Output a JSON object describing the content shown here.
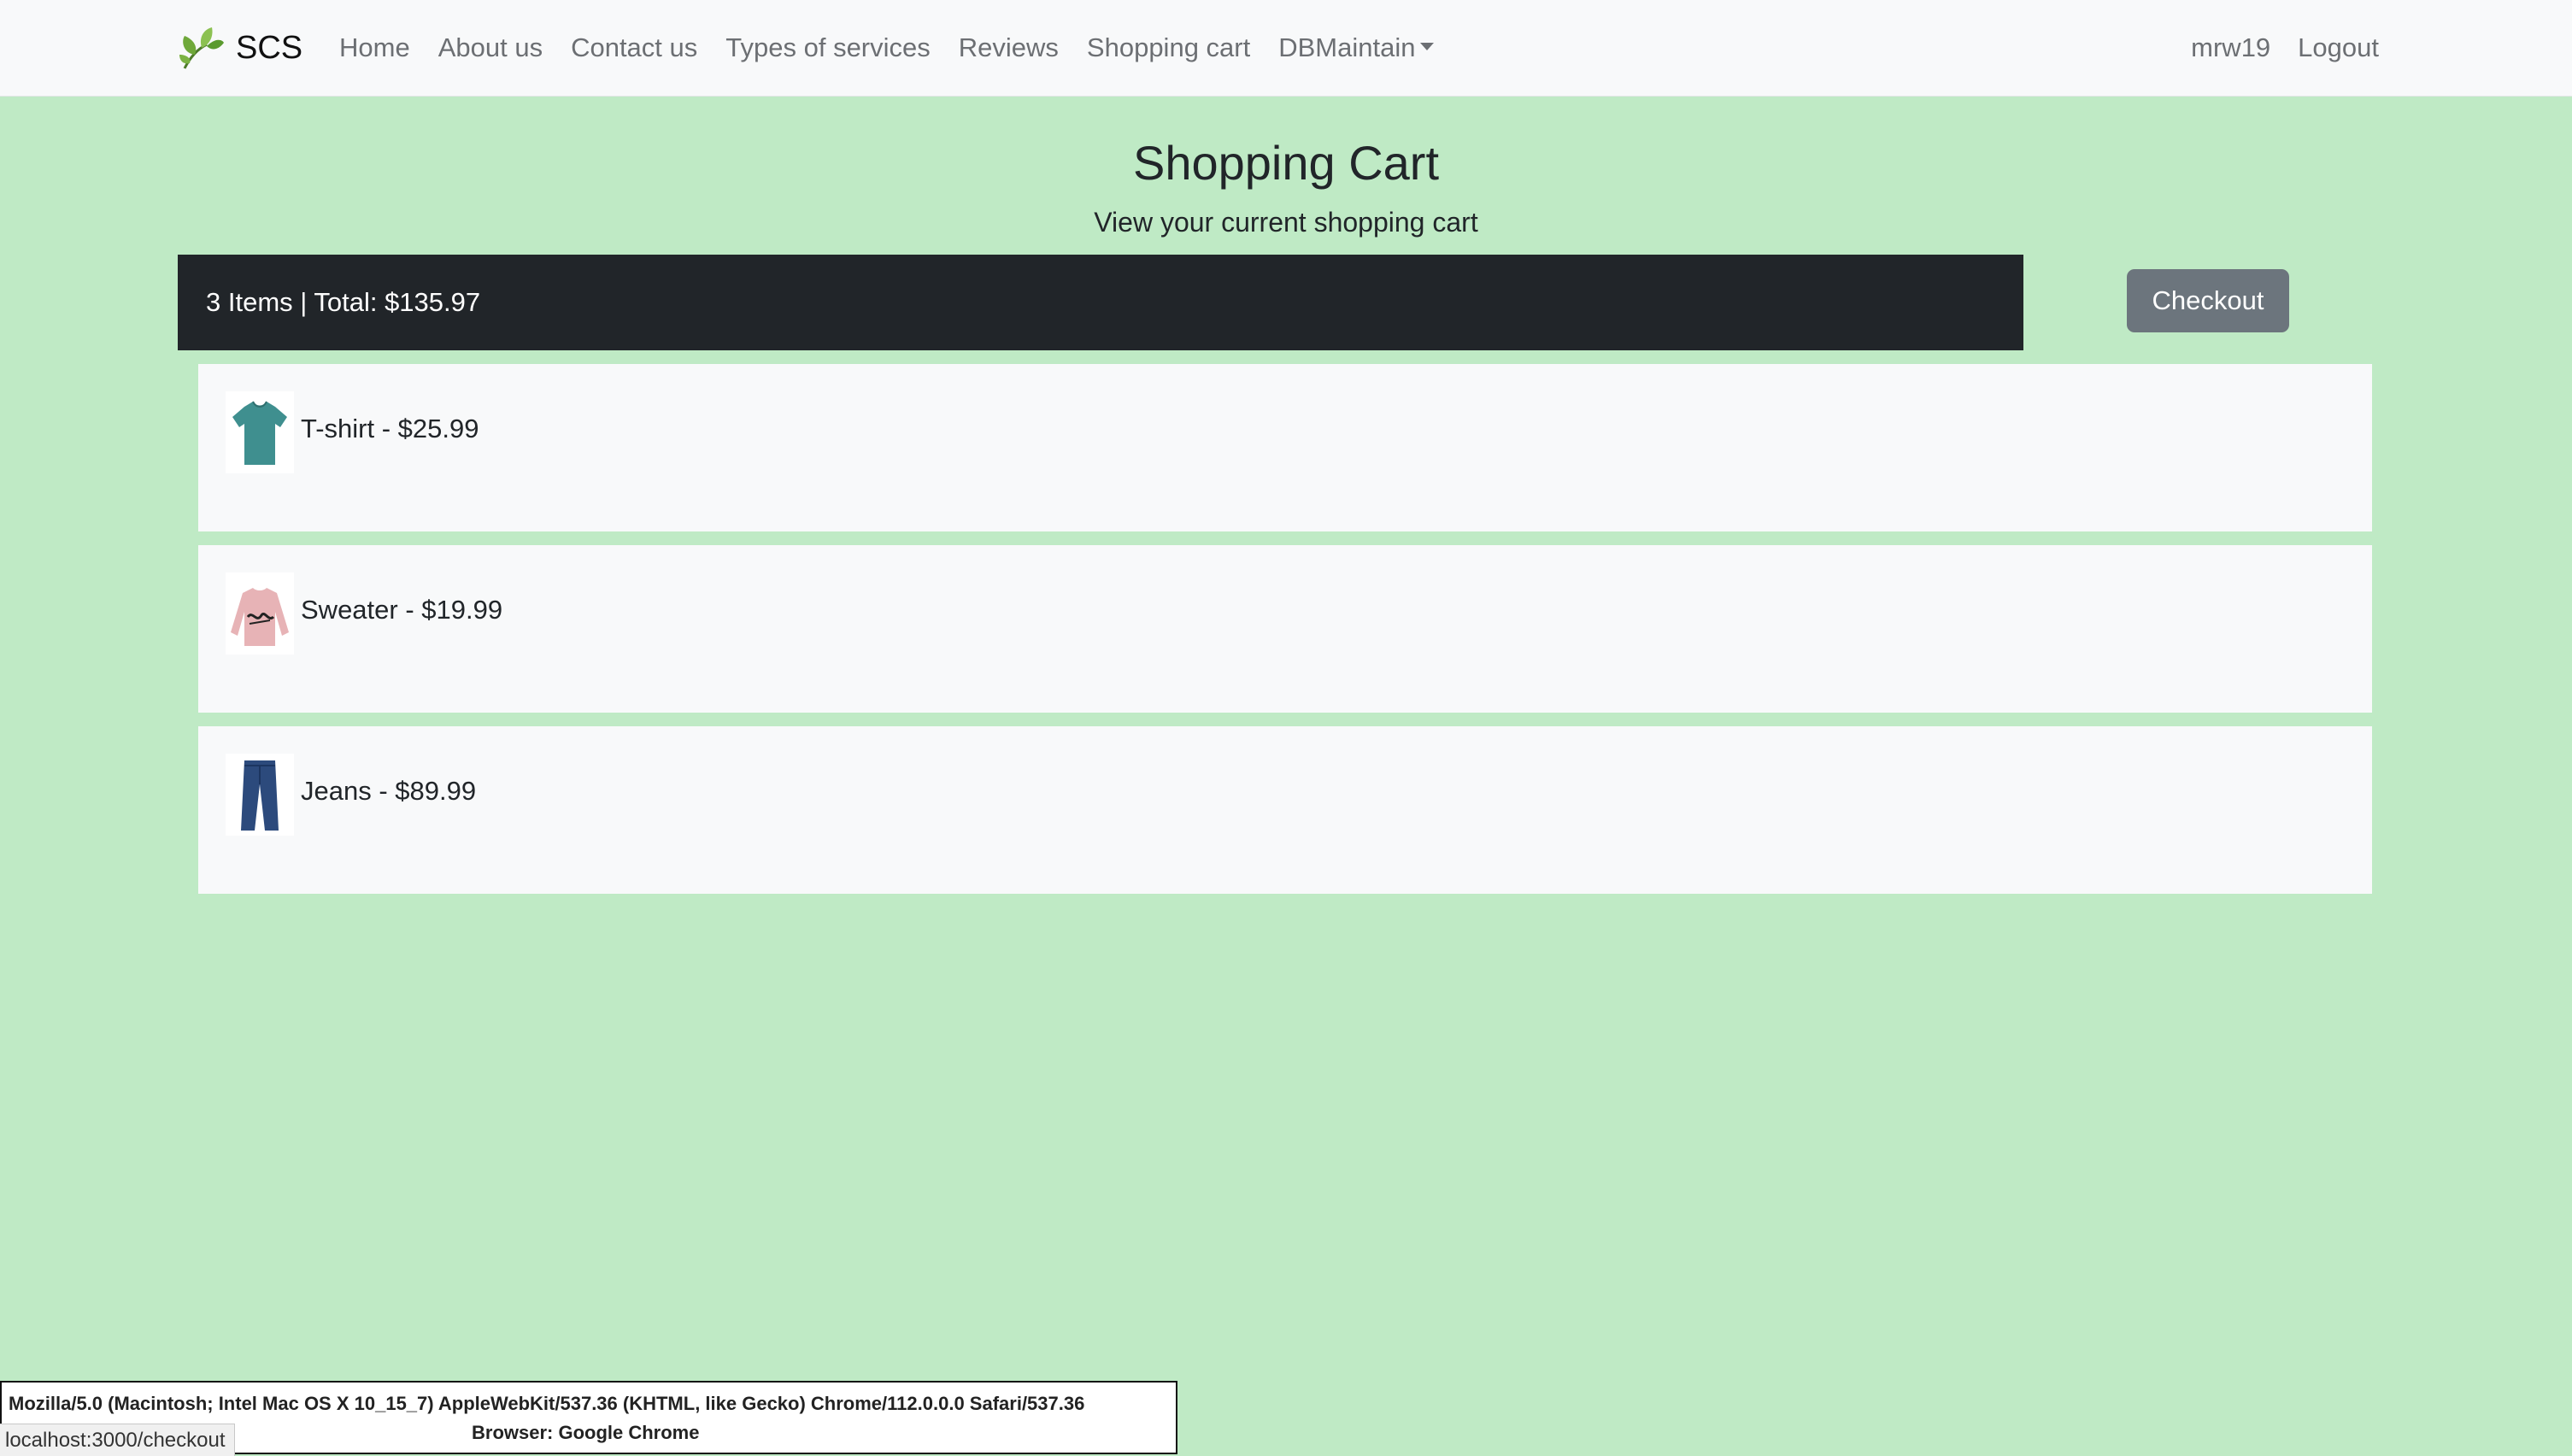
{
  "navbar": {
    "brand": "SCS",
    "links": [
      {
        "label": "Home"
      },
      {
        "label": "About us"
      },
      {
        "label": "Contact us"
      },
      {
        "label": "Types of services"
      },
      {
        "label": "Reviews"
      },
      {
        "label": "Shopping cart"
      },
      {
        "label": "DBMaintain"
      }
    ],
    "username": "mrw19",
    "logout_label": "Logout"
  },
  "header": {
    "title": "Shopping Cart",
    "subtitle": "View your current shopping cart"
  },
  "summary": {
    "text": "3 Items | Total: $135.97",
    "checkout_label": "Checkout"
  },
  "cart": {
    "items": [
      {
        "label": "T-shirt - $25.99",
        "icon": "tshirt-thumbnail",
        "color": "#3f8f8f"
      },
      {
        "label": "Sweater - $19.99",
        "icon": "sweater-thumbnail",
        "color": "#e7b3b6"
      },
      {
        "label": "Jeans - $89.99",
        "icon": "jeans-thumbnail",
        "color": "#2c4a7c"
      }
    ]
  },
  "browser_overlay": {
    "user_agent": "Mozilla/5.0 (Macintosh; Intel Mac OS X 10_15_7) AppleWebKit/537.36 (KHTML, like Gecko) Chrome/112.0.0.0 Safari/537.36",
    "browser": "Browser: Google Chrome",
    "status_url": "localhost:3000/checkout"
  },
  "colors": {
    "page_background": "#bfeac5",
    "navbar_background": "#f8f9fa",
    "summary_bar": "#212529",
    "checkout_button": "#6c757d",
    "item_card": "#f8f9fa"
  }
}
